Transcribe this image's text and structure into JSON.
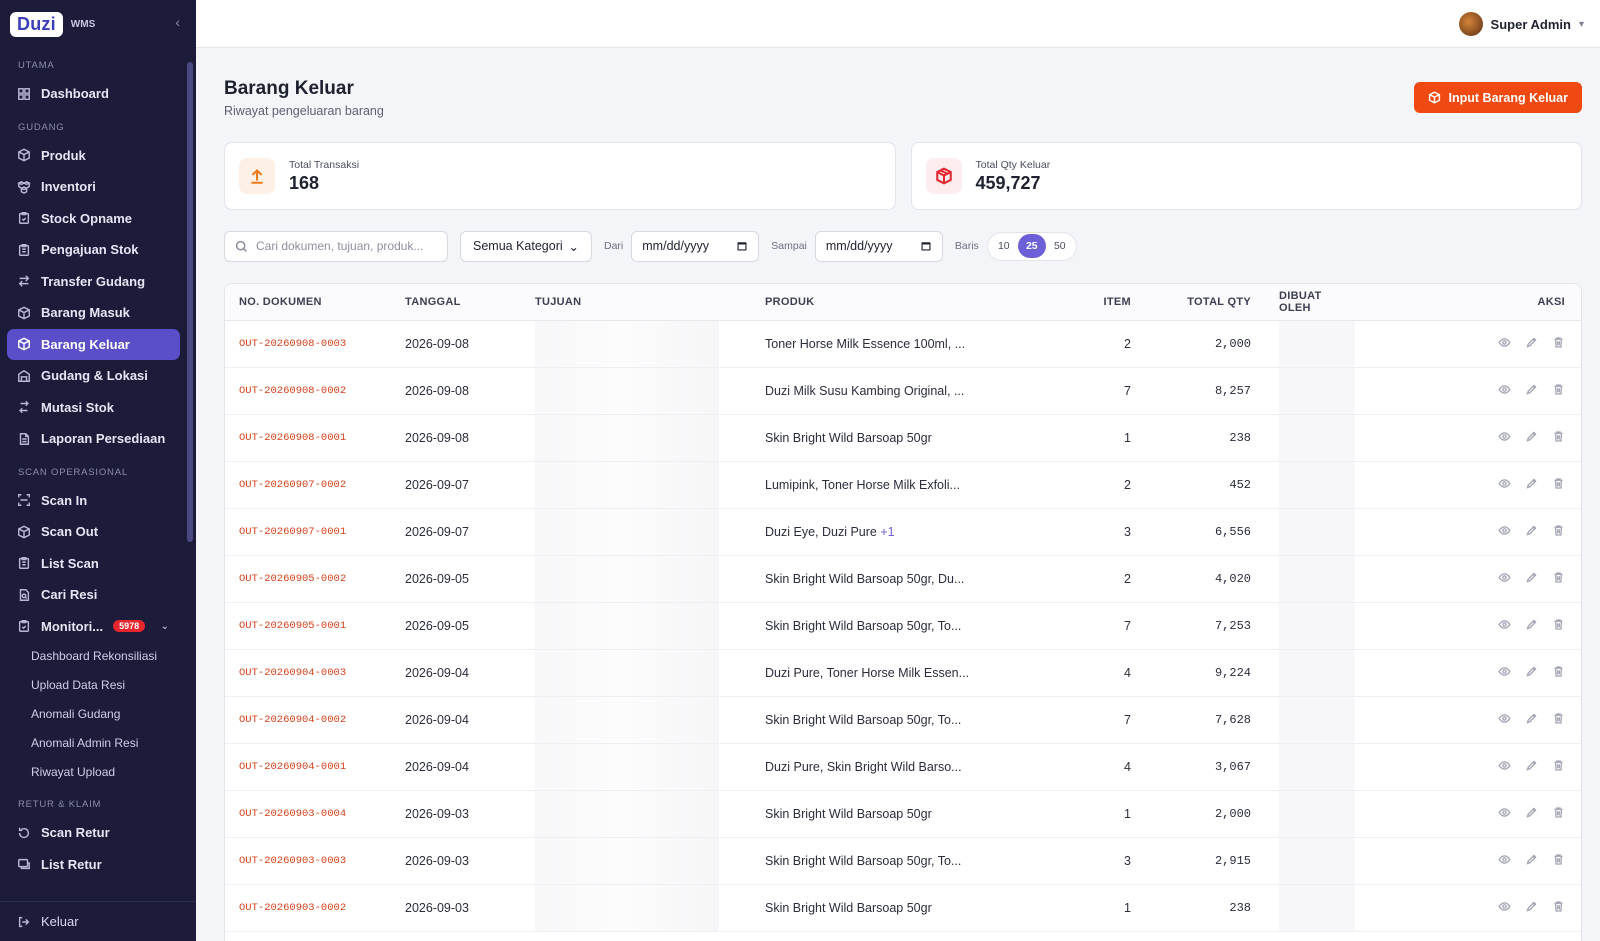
{
  "brand": {
    "logo": "Duzi",
    "app": "WMS"
  },
  "sidebar": {
    "sections": [
      {
        "title": "UTAMA",
        "items": [
          {
            "label": "Dashboard",
            "icon": "grid-icon"
          }
        ]
      },
      {
        "title": "GUDANG",
        "items": [
          {
            "label": "Produk",
            "icon": "box-icon"
          },
          {
            "label": "Inventori",
            "icon": "boxes-icon"
          },
          {
            "label": "Stock Opname",
            "icon": "clipboard-icon"
          },
          {
            "label": "Pengajuan Stok",
            "icon": "clipboard-list-icon"
          },
          {
            "label": "Transfer Gudang",
            "icon": "transfer-icon"
          },
          {
            "label": "Barang Masuk",
            "icon": "box-icon"
          },
          {
            "label": "Barang Keluar",
            "icon": "box-icon",
            "active": true
          },
          {
            "label": "Gudang & Lokasi",
            "icon": "warehouse-icon"
          },
          {
            "label": "Mutasi Stok",
            "icon": "swap-icon"
          },
          {
            "label": "Laporan Persediaan",
            "icon": "report-icon"
          }
        ]
      },
      {
        "title": "SCAN OPERASIONAL",
        "items": [
          {
            "label": "Scan In",
            "icon": "scan-icon"
          },
          {
            "label": "Scan Out",
            "icon": "box-icon"
          },
          {
            "label": "List Scan",
            "icon": "clipboard-list-icon"
          },
          {
            "label": "Cari Resi",
            "icon": "file-search-icon"
          },
          {
            "label": "Monitori...",
            "icon": "clipboard-icon",
            "badge": "5978",
            "expanded": true
          }
        ]
      },
      {
        "title": "RETUR & KLAIM",
        "items": [
          {
            "label": "Scan Retur",
            "icon": "rotate-icon"
          },
          {
            "label": "List Retur",
            "icon": "list-return-icon"
          }
        ]
      }
    ],
    "monitoring_sub": [
      "Dashboard Rekonsiliasi",
      "Upload Data Resi",
      "Anomali Gudang",
      "Anomali Admin Resi",
      "Riwayat Upload"
    ],
    "logout_label": "Keluar"
  },
  "topbar": {
    "user_name": "Super Admin"
  },
  "page": {
    "title": "Barang Keluar",
    "subtitle": "Riwayat pengeluaran barang",
    "primary_button": "Input Barang Keluar"
  },
  "stats": [
    {
      "label": "Total Transaksi",
      "value": "168",
      "icon": "upload-arrow-icon",
      "color": "#f07a1a"
    },
    {
      "label": "Total Qty Keluar",
      "value": "459,727",
      "icon": "box-icon",
      "color": "#e5262f"
    }
  ],
  "filters": {
    "search_placeholder": "Cari dokumen, tujuan, produk...",
    "category": "Semua Kategori",
    "from_label": "Dari",
    "from_value": "mm/dd/yyyy",
    "to_label": "Sampai",
    "to_value": "mm/dd/yyyy",
    "rows_label": "Baris",
    "rows_options": [
      "10",
      "25",
      "50"
    ],
    "rows_selected": "25"
  },
  "table": {
    "columns": [
      "NO. DOKUMEN",
      "TANGGAL",
      "TUJUAN",
      "PRODUK",
      "ITEM",
      "TOTAL QTY",
      "DIBUAT OLEH",
      "AKSI"
    ],
    "rows": [
      {
        "doc": "OUT-20260908-0003",
        "date": "2026-09-08",
        "product": "Toner Horse Milk Essence 100ml, ...",
        "more": "",
        "item": "2",
        "qty": "2,000"
      },
      {
        "doc": "OUT-20260908-0002",
        "date": "2026-09-08",
        "product": "Duzi Milk Susu Kambing Original, ...",
        "more": "",
        "item": "7",
        "qty": "8,257"
      },
      {
        "doc": "OUT-20260908-0001",
        "date": "2026-09-08",
        "product": "Skin Bright Wild Barsoap 50gr",
        "more": "",
        "item": "1",
        "qty": "238"
      },
      {
        "doc": "OUT-20260907-0002",
        "date": "2026-09-07",
        "product": "Lumipink, Toner Horse Milk Exfoli...",
        "more": "",
        "item": "2",
        "qty": "452"
      },
      {
        "doc": "OUT-20260907-0001",
        "date": "2026-09-07",
        "product": "Duzi Eye, Duzi Pure",
        "more": "+1",
        "item": "3",
        "qty": "6,556"
      },
      {
        "doc": "OUT-20260905-0002",
        "date": "2026-09-05",
        "product": "Skin Bright Wild Barsoap 50gr, Du...",
        "more": "",
        "item": "2",
        "qty": "4,020"
      },
      {
        "doc": "OUT-20260905-0001",
        "date": "2026-09-05",
        "product": "Skin Bright Wild Barsoap 50gr, To...",
        "more": "",
        "item": "7",
        "qty": "7,253"
      },
      {
        "doc": "OUT-20260904-0003",
        "date": "2026-09-04",
        "product": "Duzi Pure, Toner Horse Milk Essen...",
        "more": "",
        "item": "4",
        "qty": "9,224"
      },
      {
        "doc": "OUT-20260904-0002",
        "date": "2026-09-04",
        "product": "Skin Bright Wild Barsoap 50gr, To...",
        "more": "",
        "item": "7",
        "qty": "7,628"
      },
      {
        "doc": "OUT-20260904-0001",
        "date": "2026-09-04",
        "product": "Duzi Pure, Skin Bright Wild Barso...",
        "more": "",
        "item": "4",
        "qty": "3,067"
      },
      {
        "doc": "OUT-20260903-0004",
        "date": "2026-09-03",
        "product": "Skin Bright Wild Barsoap 50gr",
        "more": "",
        "item": "1",
        "qty": "2,000"
      },
      {
        "doc": "OUT-20260903-0003",
        "date": "2026-09-03",
        "product": "Skin Bright Wild Barsoap 50gr, To...",
        "more": "",
        "item": "3",
        "qty": "2,915"
      },
      {
        "doc": "OUT-20260903-0002",
        "date": "2026-09-03",
        "product": "Skin Bright Wild Barsoap 50gr",
        "more": "",
        "item": "1",
        "qty": "238"
      }
    ]
  }
}
